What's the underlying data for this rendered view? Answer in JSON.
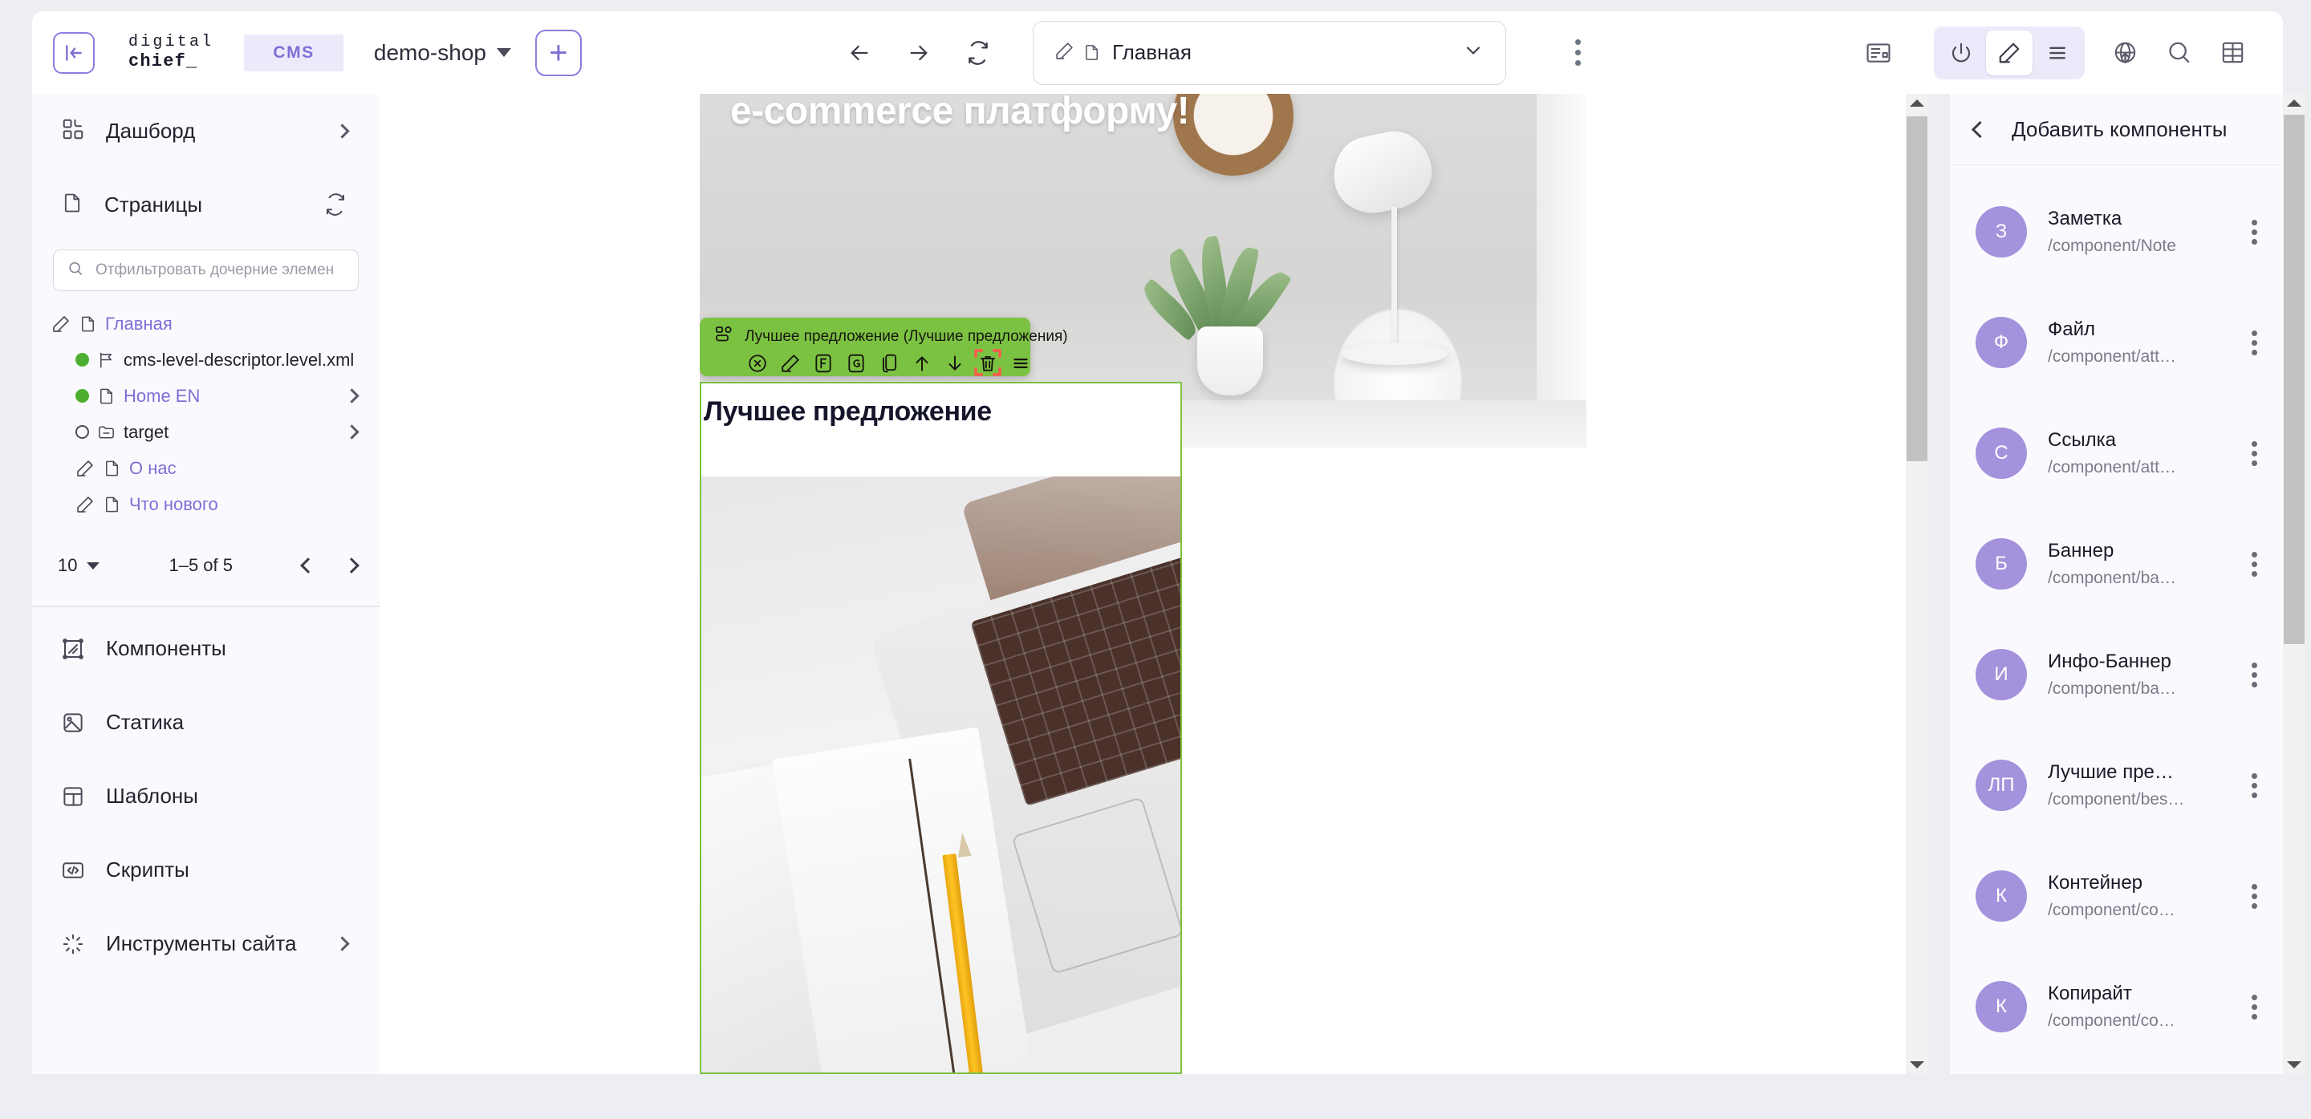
{
  "topbar": {
    "collapse_icon": "panel-collapse-left-icon",
    "logo_line1": "digital",
    "logo_line2": "chief_",
    "cms_badge": "CMS",
    "shop_name": "demo-shop",
    "add_button": "+",
    "back_icon": "arrow-left-icon",
    "forward_icon": "arrow-right-icon",
    "refresh_icon": "refresh-icon",
    "page_label": "Главная",
    "page_dropdown_icon": "chevron-down-icon",
    "kebab_icon": "more-vertical-icon",
    "right_icons": [
      {
        "name": "layout-preview-icon"
      },
      {
        "name": "power-icon"
      },
      {
        "name": "edit-pencil-icon"
      },
      {
        "name": "list-lines-icon"
      },
      {
        "name": "globe-publish-icon"
      },
      {
        "name": "search-icon"
      },
      {
        "name": "grid-table-icon"
      }
    ]
  },
  "sidebar": {
    "dashboard": "Дашборд",
    "pages": "Страницы",
    "filter_placeholder": "Отфильтровать дочерние элемен",
    "tree": [
      {
        "label": "Главная",
        "icon": "pencil-icon",
        "type_icon": "page-icon",
        "status": "none",
        "indent": 0,
        "has_chevron": false,
        "link": true
      },
      {
        "label": "cms-level-descriptor.level.xml",
        "icon": "",
        "type_icon": "flag-icon",
        "status": "green",
        "indent": 1,
        "has_chevron": false,
        "link": false
      },
      {
        "label": "Home EN",
        "icon": "",
        "type_icon": "page-icon",
        "status": "green",
        "indent": 1,
        "has_chevron": true,
        "link": true
      },
      {
        "label": "target",
        "icon": "",
        "type_icon": "folder-icon",
        "status": "hollow",
        "indent": 1,
        "has_chevron": true,
        "link": false
      },
      {
        "label": "О нас",
        "icon": "pencil-icon",
        "type_icon": "page-icon",
        "status": "none",
        "indent": 1,
        "has_chevron": false,
        "link": true
      },
      {
        "label": "Что нового",
        "icon": "pencil-icon",
        "type_icon": "page-icon",
        "status": "none",
        "indent": 1,
        "has_chevron": false,
        "link": true
      }
    ],
    "page_size": "10",
    "page_range": "1–5 of 5",
    "menu": [
      {
        "label": "Компоненты",
        "icon": "components-icon",
        "chevron": false
      },
      {
        "label": "Статика",
        "icon": "image-static-icon",
        "chevron": false
      },
      {
        "label": "Шаблоны",
        "icon": "templates-icon",
        "chevron": false
      },
      {
        "label": "Скрипты",
        "icon": "code-scripts-icon",
        "chevron": false
      },
      {
        "label": "Инструменты сайта",
        "icon": "site-tools-icon",
        "chevron": true
      }
    ]
  },
  "canvas": {
    "hero_text": "e-commerce платформу!",
    "component_toolbar": {
      "title": "Лучшее предложение (Лучшие предложения)",
      "type_icon": "component-blocks-icon",
      "actions": [
        {
          "name": "close-circle-icon",
          "glyph": "x-circle"
        },
        {
          "name": "edit-pencil-icon",
          "glyph": "pencil"
        },
        {
          "name": "form-f-icon",
          "glyph": "F"
        },
        {
          "name": "graphql-g-icon",
          "glyph": "G"
        },
        {
          "name": "duplicate-icon",
          "glyph": "copy"
        },
        {
          "name": "move-up-icon",
          "glyph": "arrow-up"
        },
        {
          "name": "move-down-icon",
          "glyph": "arrow-down"
        },
        {
          "name": "delete-trash-icon",
          "glyph": "trash",
          "highlighted": true
        },
        {
          "name": "options-menu-icon",
          "glyph": "hamburger"
        }
      ]
    },
    "card_heading": "Лучшее предложение"
  },
  "right_panel": {
    "back_icon": "chevron-left-icon",
    "title": "Добавить компоненты",
    "items": [
      {
        "initials": "З",
        "name": "Заметка",
        "path": "/component/Note"
      },
      {
        "initials": "Ф",
        "name": "Файл",
        "path": "/component/att…"
      },
      {
        "initials": "С",
        "name": "Ссылка",
        "path": "/component/att…"
      },
      {
        "initials": "Б",
        "name": "Баннер",
        "path": "/component/ba…"
      },
      {
        "initials": "И",
        "name": "Инфо-Баннер",
        "path": "/component/ba…"
      },
      {
        "initials": "ЛП",
        "name": "Лучшие пре…",
        "path": "/component/bes…"
      },
      {
        "initials": "К",
        "name": "Контейнер",
        "path": "/component/co…"
      },
      {
        "initials": "К",
        "name": "Копирайт",
        "path": "/component/co…"
      }
    ]
  },
  "colors": {
    "accent": "#7d6fd6",
    "green": "#7cc242",
    "highlight_red": "#ff5a4d",
    "sidebar_bg": "#fafafe",
    "avatar": "#a492dd"
  }
}
